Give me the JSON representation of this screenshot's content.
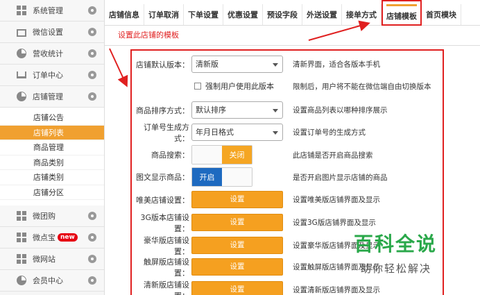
{
  "sidebar": {
    "top_items": [
      {
        "label": "系统管理",
        "icon": "grid-icon"
      },
      {
        "label": "微信设置",
        "icon": "mail-icon"
      },
      {
        "label": "营收统计",
        "icon": "pie-icon"
      },
      {
        "label": "订单中心",
        "icon": "cart-icon"
      },
      {
        "label": "店铺管理",
        "icon": "pie-icon"
      }
    ],
    "sub_items": [
      "店铺公告",
      "店铺列表",
      "商品管理",
      "商品类别",
      "店铺类别",
      "店铺分区"
    ],
    "active_sub": "店铺列表",
    "bottom_items": [
      {
        "label": "微团购",
        "icon": "grid-icon"
      },
      {
        "label": "微点宝",
        "icon": "grid-icon",
        "badge": "new"
      },
      {
        "label": "微网站",
        "icon": "grid-icon"
      },
      {
        "label": "会员中心",
        "icon": "pie-icon"
      }
    ]
  },
  "tabs": [
    "店铺信息",
    "订单取消",
    "下单设置",
    "优惠设置",
    "预设字段",
    "外送设置",
    "接单方式",
    "店铺模板",
    "首页模块"
  ],
  "active_tab": "店铺模板",
  "page_subtitle": "设置此店铺的模板",
  "form": {
    "default_version": {
      "label": "店铺默认版本：",
      "value": "清新版",
      "desc": "清新界面，适合各版本手机"
    },
    "force_version": {
      "label": "强制用户使用此版本",
      "desc": "限制后，用户将不能在微信端自由切换版本"
    },
    "sort": {
      "label": "商品排序方式：",
      "value": "默认排序",
      "desc": "设置商品列表以哪种排序展示"
    },
    "order_no": {
      "label": "订单号生成方式：",
      "value": "年月日格式",
      "desc": "设置订单号的生成方式"
    },
    "search": {
      "label": "商品搜索：",
      "state": "关闭",
      "desc": "此店铺是否开启商品搜索"
    },
    "image_display": {
      "label": "图文显示商品：",
      "state": "开启",
      "desc": "是否开启图片显示店铺的商品"
    },
    "buttons": [
      {
        "label": "唯美店铺设置：",
        "button": "设置",
        "desc": "设置唯美版店铺界面及显示"
      },
      {
        "label": "3G版本店铺设置：",
        "button": "设置",
        "desc": "设置3G版店铺界面及显示"
      },
      {
        "label": "豪华版店铺设置：",
        "button": "设置",
        "desc": "设置豪华版店铺界面及显示"
      },
      {
        "label": "触屏版店铺设置：",
        "button": "设置",
        "desc": "设置触屏版店铺界面及显示"
      },
      {
        "label": "清新版店铺设置：",
        "button": "设置",
        "desc": "设置清新版店铺界面及显示"
      }
    ]
  },
  "watermark": {
    "title": "百科全说",
    "subtitle": "助你轻松解决"
  },
  "colors": {
    "accent": "#f5a020",
    "highlight": "#e02020",
    "toggle_on": "#1e6ac0",
    "active_menu": "#f0a030"
  }
}
